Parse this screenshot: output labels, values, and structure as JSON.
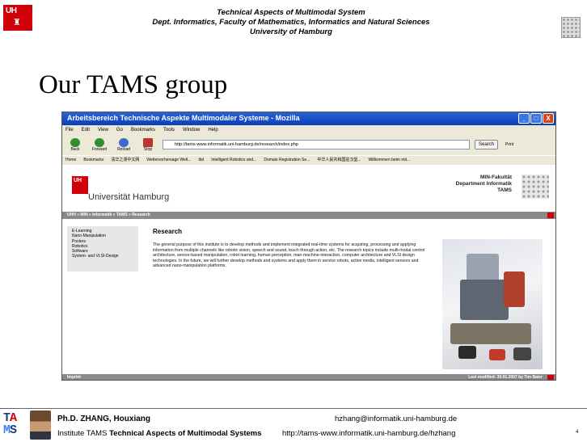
{
  "header": {
    "line1": "Technical Aspects of Multimodal System",
    "line2": "Dept. Informatics, Faculty of Mathematics, Informatics and Natural Sciences",
    "line3": "University of Hamburg",
    "uhh_logo_text": "UH",
    "uhh_logo_colour": "#d0000a"
  },
  "slide": {
    "title": "Our TAMS group"
  },
  "browser": {
    "window_title": "Arbeitsbereich Technische Aspekte Multimodaler Systeme - Mozilla",
    "window_buttons": [
      "_",
      "□",
      "X"
    ],
    "menu": [
      "File",
      "Edit",
      "View",
      "Go",
      "Bookmarks",
      "Tools",
      "Window",
      "Help"
    ],
    "nav_buttons": [
      "Back",
      "Forward",
      "Reload",
      "Stop"
    ],
    "url": "http://tams-www.informatik.uni-hamburg.de/research/index.php",
    "search_label": "Search",
    "print_label": "Print",
    "bookmarks": [
      "Home",
      "Bookmarks",
      "清华之漫中文网",
      "Wettervorhersage Welt...",
      "ibd",
      "Intelligent Robotics and...",
      "Domain Registration Se...",
      "中华人民共和国驻汉堡...",
      "Willkommen beim mit..."
    ],
    "page": {
      "uhh_logo_text": "UH",
      "university": "Universität Hamburg",
      "dept_line1": "MIN-Fakultät",
      "dept_line2": "Department Informatik",
      "dept_line3": "TAMS",
      "breadcrumb": "UHH » MIN » Informatik » TAMS » Research",
      "side_menu": [
        "E-Learning",
        "Nano-Manipulation",
        "Posters",
        "Robotics",
        "Software",
        "System- and VLSI-Design"
      ],
      "heading": "Research",
      "body": "The general purpose of this institute is to develop methods and implement integrated real-time systems for acquiring, processing and applying information from multiple channels like robotic vision, speech and sound, touch through action, etc. The research topics include multi-modal control architecture, sensor-based manipulation, robot learning, human perception, man-machine-interaction, computer architecture and VLSI design technologies. In the future, we will further develop methods and systems and apply them in service robots, active media, intelligent sensors and advanced nano-manipulation platforms.",
      "status_left": "Imprint",
      "status_right": "Last modified: 30.01.2007 by Tim Baier"
    }
  },
  "footer": {
    "tams_letters": [
      "T",
      "A",
      "M",
      "S"
    ],
    "author": "Ph.D. ZHANG, Houxiang",
    "institute_prefix": "Institute TAMS ",
    "institute_bold": "Technical Aspects of Multimodal Systems",
    "email": "hzhang@informatik.uni-hamburg.de",
    "website": "http://tams-www.informatik.uni-hamburg.de/hzhang",
    "page_number": "4"
  }
}
